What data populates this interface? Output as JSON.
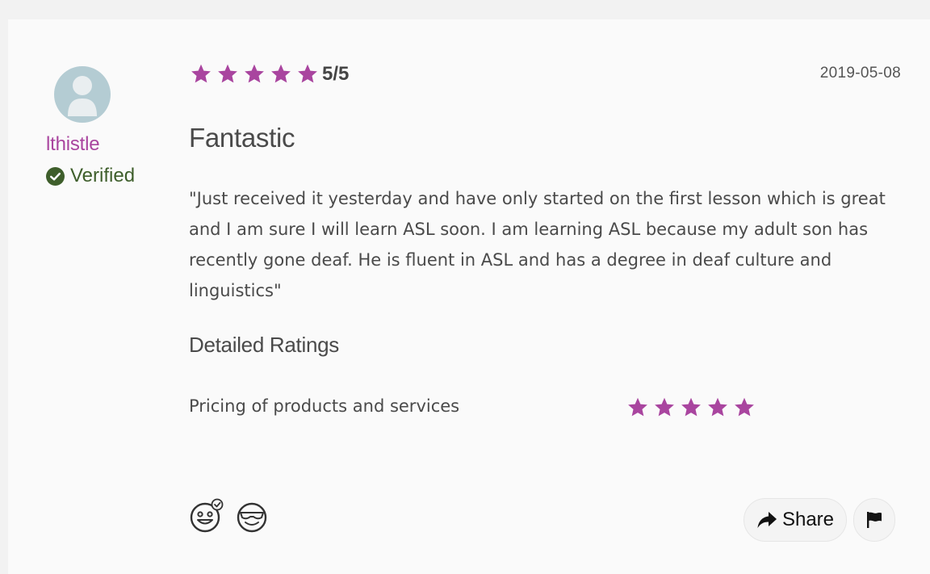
{
  "review": {
    "reviewer": {
      "username": "lthistle",
      "verified_label": "Verified"
    },
    "rating": {
      "stars": 5,
      "max": 5,
      "text": "5/5"
    },
    "date": "2019-05-08",
    "title": "Fantastic",
    "body": "\"Just received it yesterday and have only started on the first lesson which is great and I am sure I will learn ASL soon. I am learning ASL because my adult son has recently gone deaf. He is fluent in ASL and has a degree in deaf culture and linguistics\"",
    "detailed_ratings": {
      "heading": "Detailed Ratings",
      "items": [
        {
          "label": "Pricing of products and services",
          "stars": 5
        }
      ]
    },
    "actions": {
      "share_label": "Share",
      "reactions": [
        {
          "icon": "happy-face-check-icon"
        },
        {
          "icon": "cool-face-sunglasses-icon"
        }
      ],
      "flag_icon": "flag-icon"
    }
  },
  "colors": {
    "star": "#a9459f",
    "username": "#a9459f",
    "verified": "#3e5e2b",
    "avatar_bg": "#b4ccd3",
    "text": "#4a4a4a"
  }
}
